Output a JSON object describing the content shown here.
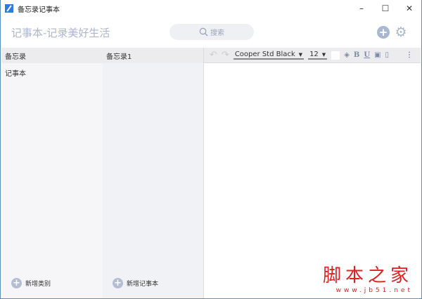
{
  "window": {
    "title": "备忘录记事本",
    "minimize": "–",
    "maximize": "☐",
    "close": "✕"
  },
  "header": {
    "brand": "记事本-记录美好生活",
    "search_placeholder": "搜索",
    "add_icon": "+",
    "settings_icon": "⚙"
  },
  "categories": {
    "header": "备忘录",
    "items": [
      "记事本"
    ],
    "add_label": "新增类别"
  },
  "notes": {
    "header": "备忘录1",
    "add_label": "新增记事本"
  },
  "editor": {
    "undo": "↶",
    "redo": "↷",
    "font": "Cooper Std Black",
    "size": "12",
    "bold": "B",
    "underline": "U",
    "more": "⋮"
  },
  "watermark": {
    "main": "脚本之家",
    "url": "www.jb51.net"
  }
}
